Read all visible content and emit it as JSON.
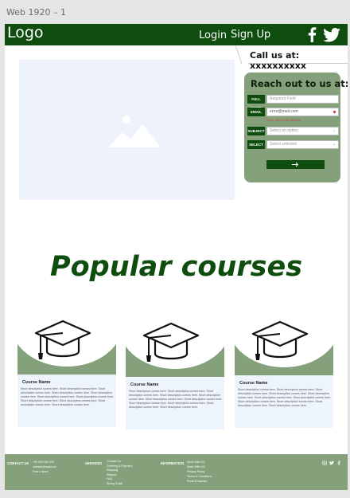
{
  "frame": {
    "title": "Web 1920 – 1"
  },
  "header": {
    "logo": "Logo",
    "nav": {
      "login": "Login",
      "signup": "Sign Up"
    },
    "social": [
      "facebook-icon",
      "twitter-icon"
    ]
  },
  "callbar": {
    "text": "Call us at: xxxxxxxxxx"
  },
  "hero": {
    "image": "image-placeholder-icon"
  },
  "contact": {
    "title": "Reach out to us at:",
    "fields": [
      {
        "tag": "FULL NAME",
        "placeholder": "Required Field"
      },
      {
        "tag": "EMAIL",
        "value": "error@mail.com",
        "error": "Not a valid email address"
      },
      {
        "tag": "SUBJECT",
        "placeholder": "Select an option"
      },
      {
        "tag": "SELECT",
        "placeholder": "Select selected"
      }
    ],
    "submit": "arrow-right-icon"
  },
  "popular": {
    "heading": "Popular courses",
    "courses": [
      {
        "name": "Course Name",
        "desc": "Short description comes here. Short description comes here. Short description comes here. Short description comes here. Short description comes here. Short description comes here. Short description comes here. Short description comes here. Short description comes here. Short description comes here. Short description comes here."
      },
      {
        "name": "Course Name",
        "desc": "Short description comes here. Short description comes here. Short description comes here. Short description comes here. Short description comes here. Short description comes here. Short description comes here. Short description comes here. Short description comes here. Short description comes here. Short description comes here."
      },
      {
        "name": "Course Name",
        "desc": "Short description comes here. Short description comes here. Short description comes here. Short description comes here. Short description comes here. Short description comes here. Short description comes here. Short description comes here. Short description comes here. Short description comes here. Short description comes here."
      }
    ]
  },
  "footer": {
    "contact_label": "CONTACT US",
    "contact_lines": [
      "+90 500 000 000",
      "website@mail.com",
      "Find a Store"
    ],
    "services_label": "SERVICES",
    "services": [
      "Contact Us",
      "Ordering & Payment",
      "Shipping",
      "Returns",
      "FAQ",
      "Sizing Guide"
    ],
    "info_label": "INFORMATION",
    "info": [
      "Work With US",
      "Work With US",
      "Privacy Policy",
      "Terms & Conditions",
      "Press Enquiries"
    ],
    "social": [
      "instagram-icon",
      "twitter-icon",
      "facebook-icon"
    ]
  },
  "colors": {
    "primary": "#0f4d0f",
    "accent": "#84a17b",
    "card_bg": "#eef4fb"
  }
}
